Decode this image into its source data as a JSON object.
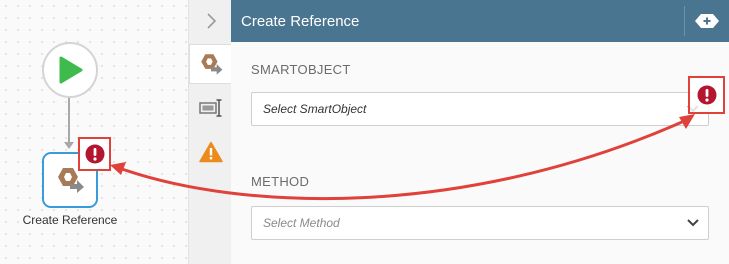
{
  "canvas": {
    "step": {
      "label": "Create Reference"
    }
  },
  "icons": {
    "start": "play-icon",
    "step": "smartobject-step-icon",
    "error": "exclamation-circle-icon",
    "rail_collapse": "chevron-right-icon",
    "rail_config": "smartobject-step-icon",
    "rail_properties": "text-field-icon",
    "rail_warnings": "warning-triangle-icon",
    "header_action": "add-icon",
    "dropdown": "chevron-down-icon"
  },
  "panel": {
    "title": "Create Reference",
    "smartobject": {
      "label": "SMARTOBJECT",
      "value": "Select SmartObject"
    },
    "method": {
      "label": "METHOD",
      "placeholder": "Select Method"
    }
  },
  "colors": {
    "header_bg": "#4a7590",
    "start_green": "#3fbb4e",
    "error_red": "#b3162e",
    "callout_red": "#e0413a",
    "warning_orange": "#ec8b1c",
    "node_border": "#3b9ad9",
    "step_icon_brown": "#8a6345"
  }
}
